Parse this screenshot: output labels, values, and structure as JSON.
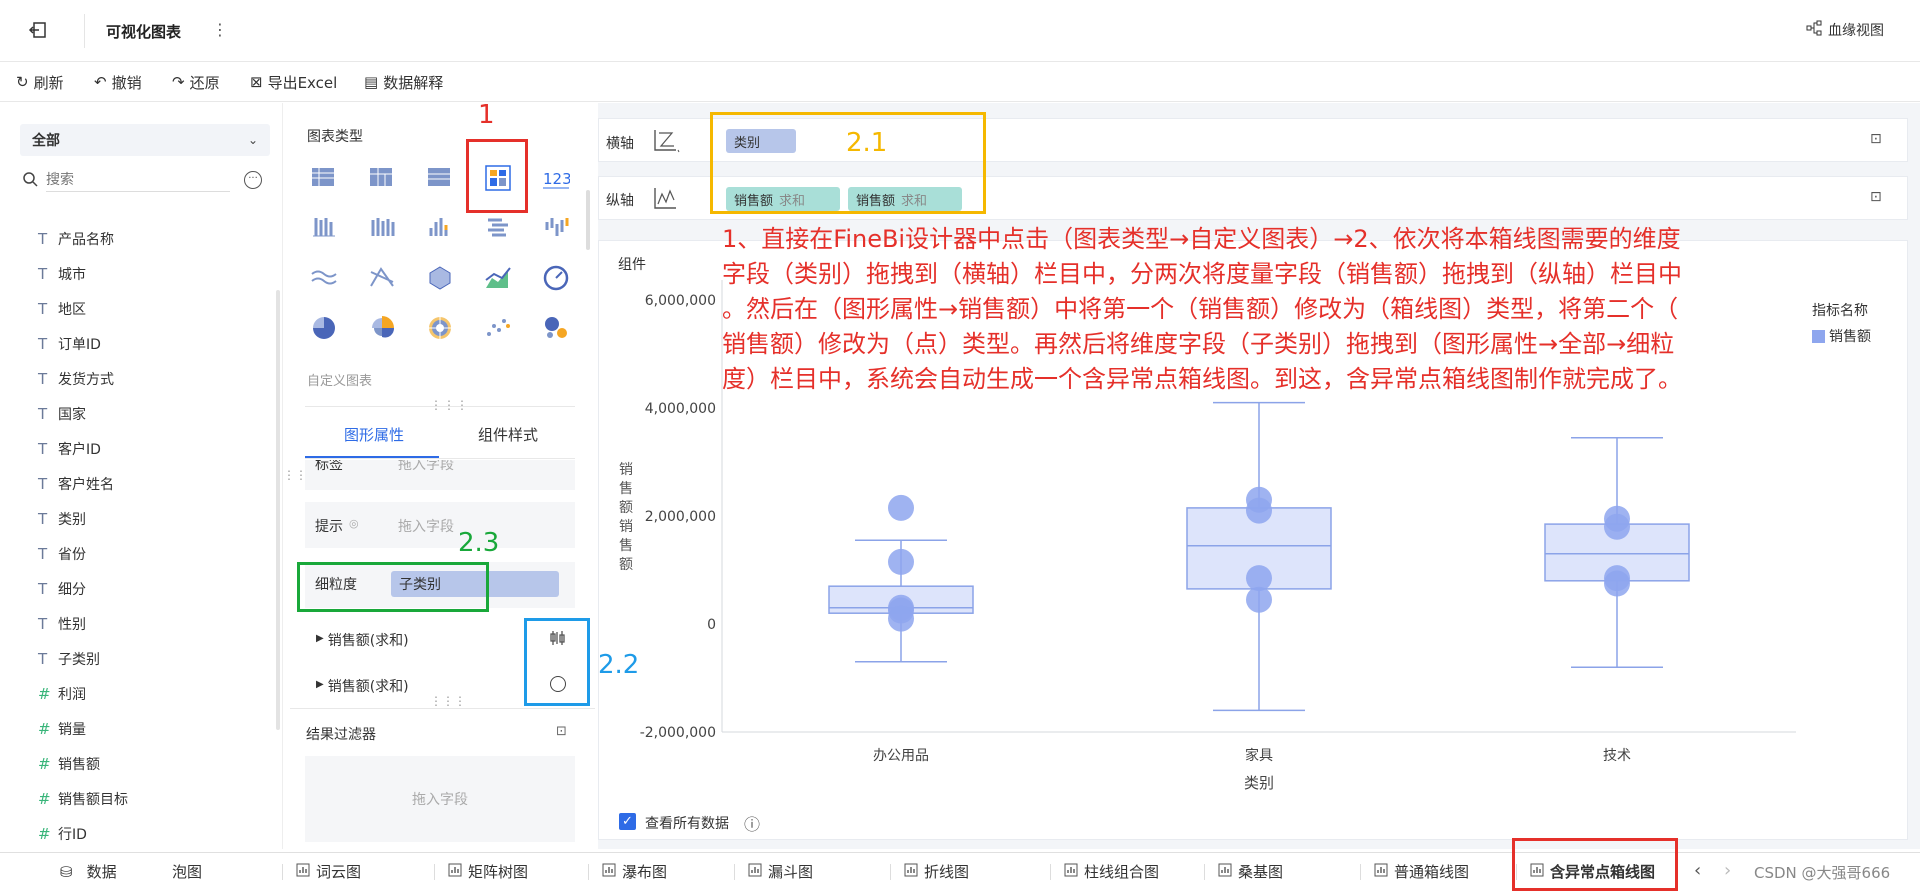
{
  "topbar": {
    "title": "可视化图表",
    "more": "⋮",
    "lineage_label": "血缘视图"
  },
  "toolbar": {
    "refresh": "刷新",
    "undo": "撤销",
    "redo": "还原",
    "export": "导出Excel",
    "explain": "数据解释"
  },
  "left": {
    "selector": "全部",
    "search_placeholder": "搜索",
    "fields": [
      {
        "type": "T",
        "label": "产品名称"
      },
      {
        "type": "T",
        "label": "城市"
      },
      {
        "type": "T",
        "label": "地区"
      },
      {
        "type": "T",
        "label": "订单ID"
      },
      {
        "type": "T",
        "label": "发货方式"
      },
      {
        "type": "T",
        "label": "国家"
      },
      {
        "type": "T",
        "label": "客户ID"
      },
      {
        "type": "T",
        "label": "客户姓名"
      },
      {
        "type": "T",
        "label": "类别"
      },
      {
        "type": "T",
        "label": "省份"
      },
      {
        "type": "T",
        "label": "细分"
      },
      {
        "type": "T",
        "label": "性别"
      },
      {
        "type": "T",
        "label": "子类别"
      },
      {
        "type": "#",
        "label": "利润"
      },
      {
        "type": "#",
        "label": "销量"
      },
      {
        "type": "#",
        "label": "销售额"
      },
      {
        "type": "#",
        "label": "销售额目标"
      },
      {
        "type": "#",
        "label": "行ID"
      }
    ]
  },
  "middle": {
    "chart_type_label": "图表类型",
    "custom_chart_label": "自定义图表",
    "tab_shape": "图形属性",
    "tab_style": "组件样式",
    "partial_label": "标签",
    "partial_placeholder": "拖入字段",
    "tooltip_label": "提示",
    "tooltip_placeholder": "拖入字段",
    "granularity_label": "细粒度",
    "granularity_value": "子类别",
    "measure1": "销售额(求和)",
    "measure2": "销售额(求和)",
    "filter_label": "结果过滤器",
    "filter_placeholder": "拖入字段"
  },
  "axes": {
    "x_label": "横轴",
    "y_label": "纵轴",
    "x_pill": "类别",
    "y_pill1": "销售额",
    "y_pill1_agg": "求和",
    "y_pill2": "销售额",
    "y_pill2_agg": "求和"
  },
  "chart_card": {
    "group_label": "组件",
    "legend_title": "指标名称",
    "legend_item": "销售额",
    "checkbox_label": "查看所有数据",
    "info_icon": "ⓘ"
  },
  "chart_data": {
    "type": "box",
    "xlabel": "类别",
    "ylabel": "销售额 销售额",
    "ylim": [
      -2000000,
      6000000
    ],
    "yticks": [
      "6,000,000",
      "4,000,000",
      "2,000,000",
      "0",
      "-2,000,000"
    ],
    "ytick_values": [
      6000000,
      4000000,
      2000000,
      0,
      -2000000
    ],
    "categories": [
      "办公用品",
      "家具",
      "技术"
    ],
    "boxes": [
      {
        "category": "办公用品",
        "min": -700000,
        "q1": 200000,
        "median": 300000,
        "q3": 700000,
        "max": 1550000
      },
      {
        "category": "家具",
        "min": -1600000,
        "q1": 650000,
        "median": 1450000,
        "q3": 2150000,
        "max": 4100000
      },
      {
        "category": "技术",
        "min": -800000,
        "q1": 800000,
        "median": 1300000,
        "q3": 1850000,
        "max": 3450000
      }
    ],
    "points": [
      {
        "category": "办公用品",
        "values": [
          2150000,
          1150000,
          300000,
          250000,
          100000
        ]
      },
      {
        "category": "家具",
        "values": [
          2300000,
          2100000,
          850000,
          450000
        ]
      },
      {
        "category": "技术",
        "values": [
          1950000,
          1800000,
          850000,
          750000
        ]
      }
    ],
    "series": [
      {
        "name": "销售额"
      }
    ],
    "legend": "top-right",
    "grid": true
  },
  "annotations": {
    "n1": "1",
    "n21": "2.1",
    "n22": "2.2",
    "n23": "2.3",
    "instruction": [
      "1、直接在FineBi设计器中点击（图表类型→自定义图表）→2、依次将本箱线图需要的维度",
      "字段（类别）拖拽到（横轴）栏目中，分两次将度量字段（销售额）拖拽到（纵轴）栏目中",
      "。然后在（图形属性→销售额）中将第一个（销售额）修改为（箱线图）类型，将第二个（",
      "销售额）修改为（点）类型。再然后将维度字段（子类别）拖拽到（图形属性→全部→细粒",
      "度）栏目中，系统会自动生成一个含异常点箱线图。到这，含异常点箱线图制作就完成了。"
    ]
  },
  "bottom": {
    "data_tab": "数据",
    "tabs": [
      "泡图",
      "词云图",
      "矩阵树图",
      "瀑布图",
      "漏斗图",
      "折线图",
      "柱线组合图",
      "桑基图",
      "普通箱线图",
      "含异常点箱线图"
    ],
    "watermark": "CSDN @大强哥666"
  },
  "colors": {
    "accent": "#2e6be6",
    "box_fill": "#dde4fb",
    "box_stroke": "#8ba3e8",
    "point": "#8ea6ee",
    "annotation_red": "#e5302a",
    "annotation_orange": "#f5b800",
    "annotation_green": "#19a83a",
    "annotation_blue": "#1e9be8"
  }
}
